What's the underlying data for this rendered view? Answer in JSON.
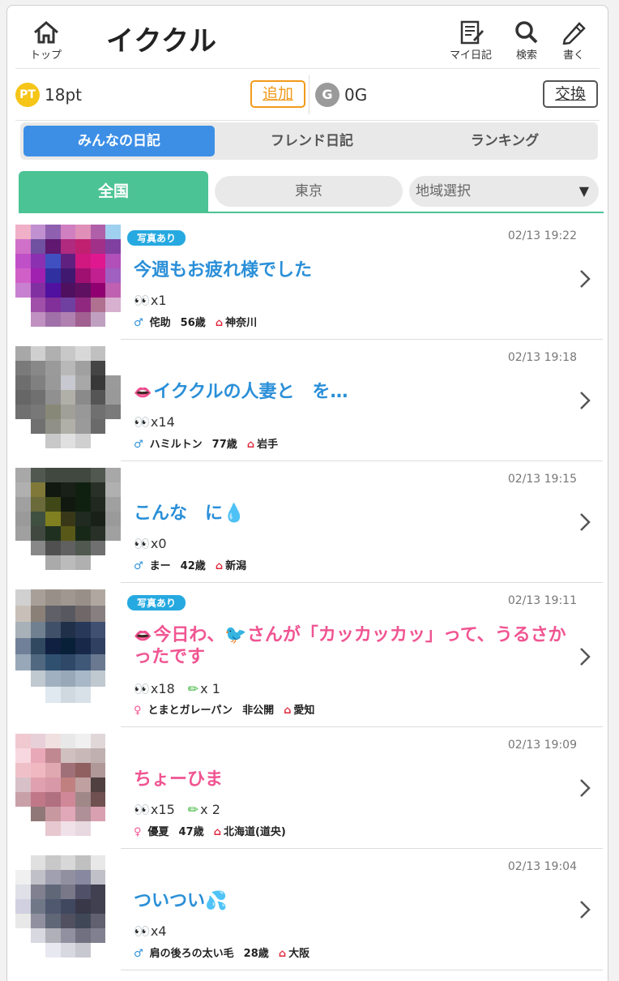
{
  "header": {
    "home_label": "トップ",
    "title": "イククル",
    "mydiary_label": "マイ日記",
    "search_label": "検索",
    "write_label": "書く"
  },
  "points": {
    "pt_badge": "PT",
    "pt_value": "18pt",
    "add_label": "追加",
    "g_badge": "G",
    "g_value": "0G",
    "exchange_label": "交換"
  },
  "tabs": [
    {
      "label": "みんなの日記",
      "active": true
    },
    {
      "label": "フレンド日記",
      "active": false
    },
    {
      "label": "ランキング",
      "active": false
    }
  ],
  "regions": {
    "all": "全国",
    "tokyo": "東京",
    "select": "地域選択",
    "caret": "▼"
  },
  "colors": {
    "accent_blue": "#3d8fe6",
    "region_green": "#4cc394",
    "title_blue": "#2a8fd8",
    "title_pink": "#f05592",
    "badge_blue": "#26a9e0",
    "add_orange": "#f29a1a"
  },
  "entries": [
    {
      "badge": "写真あり",
      "time": "02/13 19:22",
      "title": "今週もお疲れ様でした",
      "title_color": "blue",
      "lips": false,
      "views": "x1",
      "comments": "",
      "gender": "♂",
      "name": "侘助",
      "age": "56歳",
      "region": "神奈川"
    },
    {
      "badge": "",
      "time": "02/13 19:18",
      "title": "イククルの人妻と　を…",
      "title_color": "blue",
      "lips": true,
      "views": "x14",
      "comments": "",
      "gender": "♂",
      "name": "ハミルトン",
      "age": "77歳",
      "region": "岩手"
    },
    {
      "badge": "",
      "time": "02/13 19:15",
      "title": "こんな　に💧",
      "title_color": "blue",
      "lips": false,
      "views": "x0",
      "comments": "",
      "gender": "♂",
      "name": "まー",
      "age": "42歳",
      "region": "新潟"
    },
    {
      "badge": "写真あり",
      "time": "02/13 19:11",
      "title": "今日わ、🐦さんが「カッカッカッ」って、うるさかったです",
      "title_color": "pink",
      "lips": true,
      "views": "x18",
      "comments": "x 1",
      "gender": "♀",
      "name": "とまとガレーパン",
      "age": "非公開",
      "region": "愛知"
    },
    {
      "badge": "",
      "time": "02/13 19:09",
      "title": "ちょーひま",
      "title_color": "pink",
      "lips": false,
      "views": "x15",
      "comments": "x 2",
      "gender": "♀",
      "name": "優夏",
      "age": "47歳",
      "region": "北海道(道央)"
    },
    {
      "badge": "",
      "time": "02/13 19:04",
      "title": "ついつい💦",
      "title_color": "blue",
      "lips": false,
      "views": "x4",
      "comments": "",
      "gender": "♂",
      "name": "肩の後ろの太い毛",
      "age": "28歳",
      "region": "大阪"
    }
  ]
}
